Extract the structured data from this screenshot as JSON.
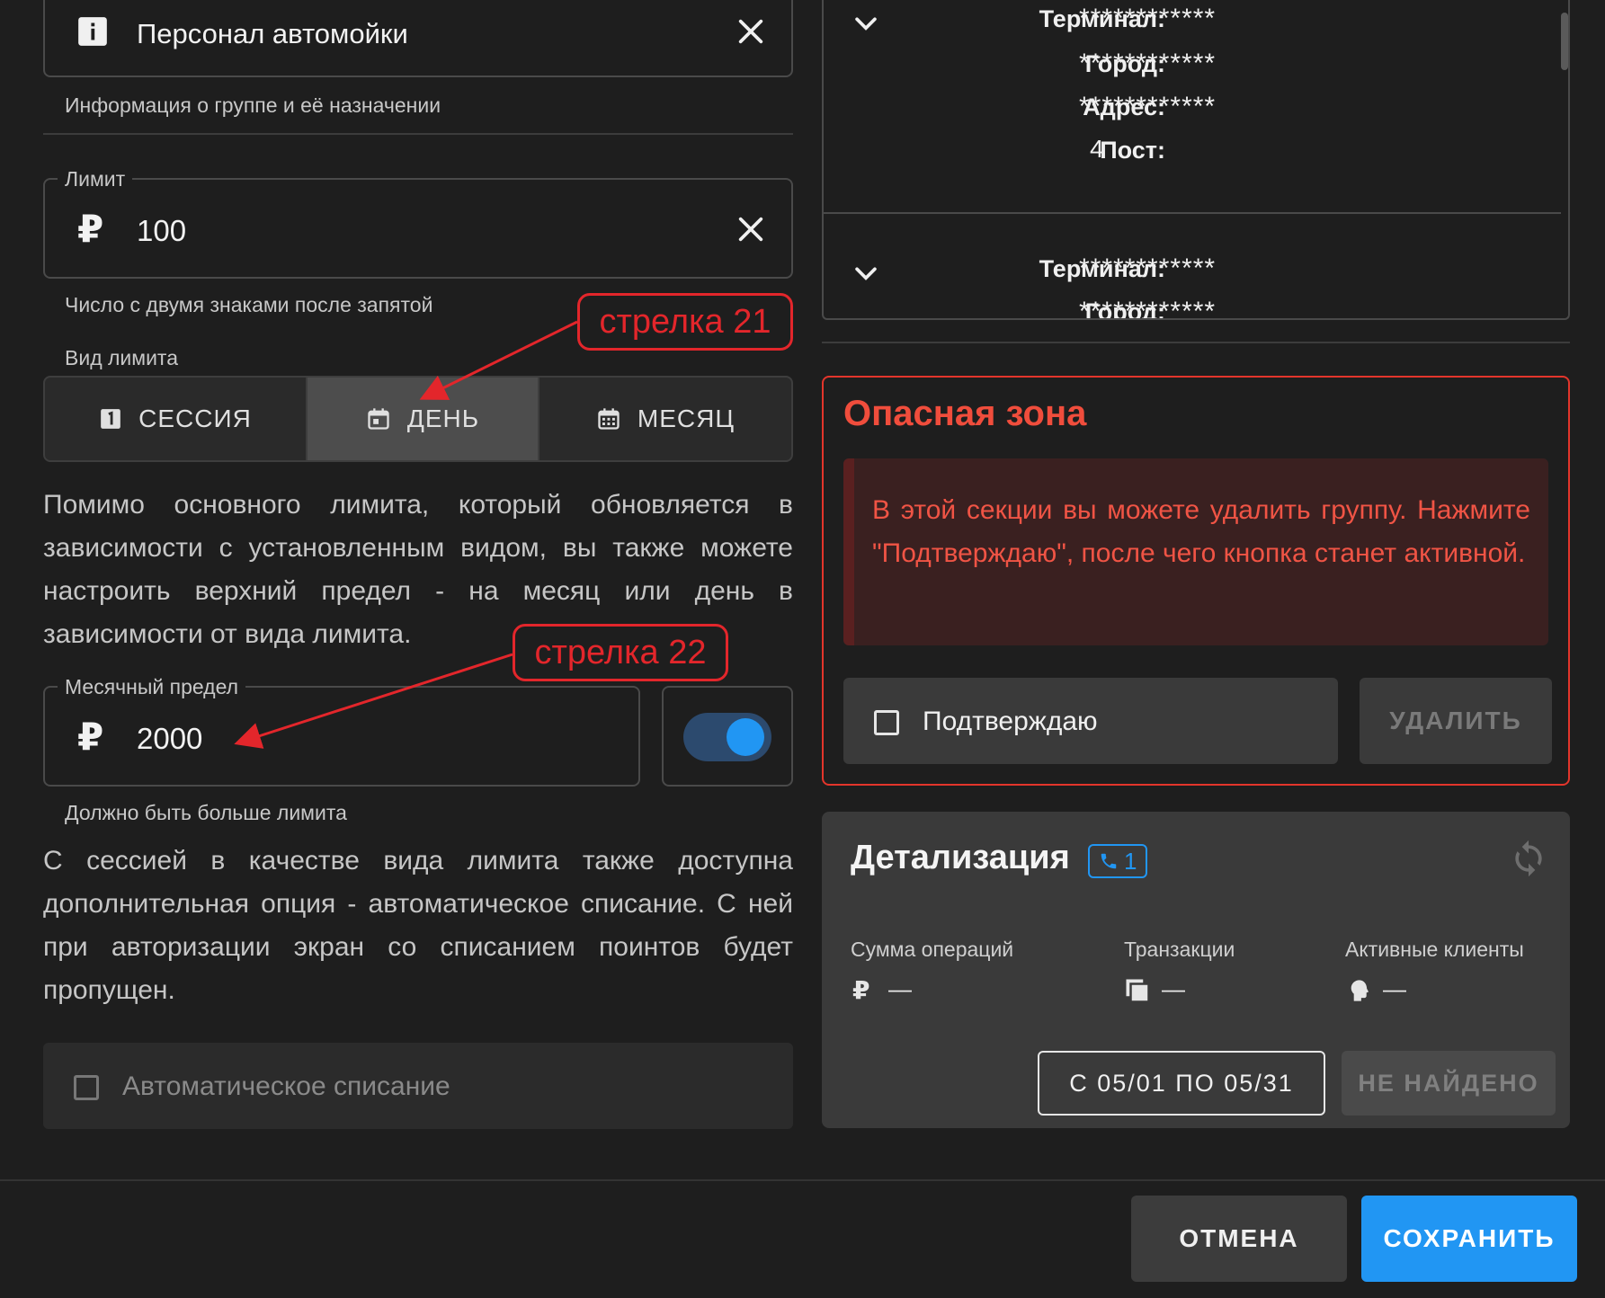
{
  "group_name": {
    "value": "Персонал автомойки",
    "helper": "Информация о группе и её назначении"
  },
  "limit": {
    "legend": "Лимит",
    "value": "100",
    "currency_symbol": "₽",
    "helper": "Число с двумя знаками после запятой"
  },
  "limit_type": {
    "label": "Вид лимита",
    "options": [
      {
        "label": "СЕССИЯ",
        "icon": "calendar-one-icon"
      },
      {
        "label": "ДЕНЬ",
        "icon": "calendar-today-icon"
      },
      {
        "label": "МЕСЯЦ",
        "icon": "calendar-month-icon"
      }
    ],
    "selected": "ДЕНЬ"
  },
  "paragraph_upper_limit": "Помимо основного лимита, который обновляется в зависимости с установленным видом, вы также можете настроить верхний предел - на месяц или день в зависимости от вида лимита.",
  "monthly_limit": {
    "legend": "Месячный предел",
    "value": "2000",
    "currency_symbol": "₽",
    "helper": "Должно быть больше лимита",
    "enabled": true
  },
  "paragraph_auto_writeoff": "С сессией в качестве вида лимита также доступна дополнительная опция - автоматическое списание. С ней при авторизации экран со списанием поинтов будет пропущен.",
  "auto_writeoff": {
    "label": "Автоматическое списание",
    "checked": false
  },
  "annotations": {
    "callout_21": "стрелка 21",
    "callout_22": "стрелка 22"
  },
  "terminals": {
    "labels": {
      "terminal": "Терминал:",
      "city": "Город:",
      "address": "Адрес:",
      "post": "Пост:"
    },
    "items": [
      {
        "terminal": "************",
        "city": "************",
        "address": "************",
        "post": "4"
      },
      {
        "terminal": "************",
        "city": "************"
      }
    ]
  },
  "danger_zone": {
    "title": "Опасная зона",
    "message": "В этой секции вы можете удалить группу. Нажмите \"Подтверждаю\", после чего кнопка станет активной.",
    "confirm_label": "Подтверждаю",
    "delete_label": "УДАЛИТЬ"
  },
  "details": {
    "title": "Детализация",
    "badge_count": "1",
    "stats": [
      {
        "label": "Сумма операций",
        "value": "—",
        "icon": "ruble-icon"
      },
      {
        "label": "Транзакции",
        "value": "—",
        "icon": "copy-icon"
      },
      {
        "label": "Активные клиенты",
        "value": "—",
        "icon": "head-icon"
      }
    ],
    "date_range": "С 05/01 ПО 05/31",
    "status": "НЕ НАЙДЕНО"
  },
  "footer": {
    "cancel_label": "ОТМЕНА",
    "save_label": "СОХРАНИТЬ"
  },
  "colors": {
    "accent": "#2196f3",
    "danger": "#f04d3c",
    "annotation": "#e3262b"
  }
}
